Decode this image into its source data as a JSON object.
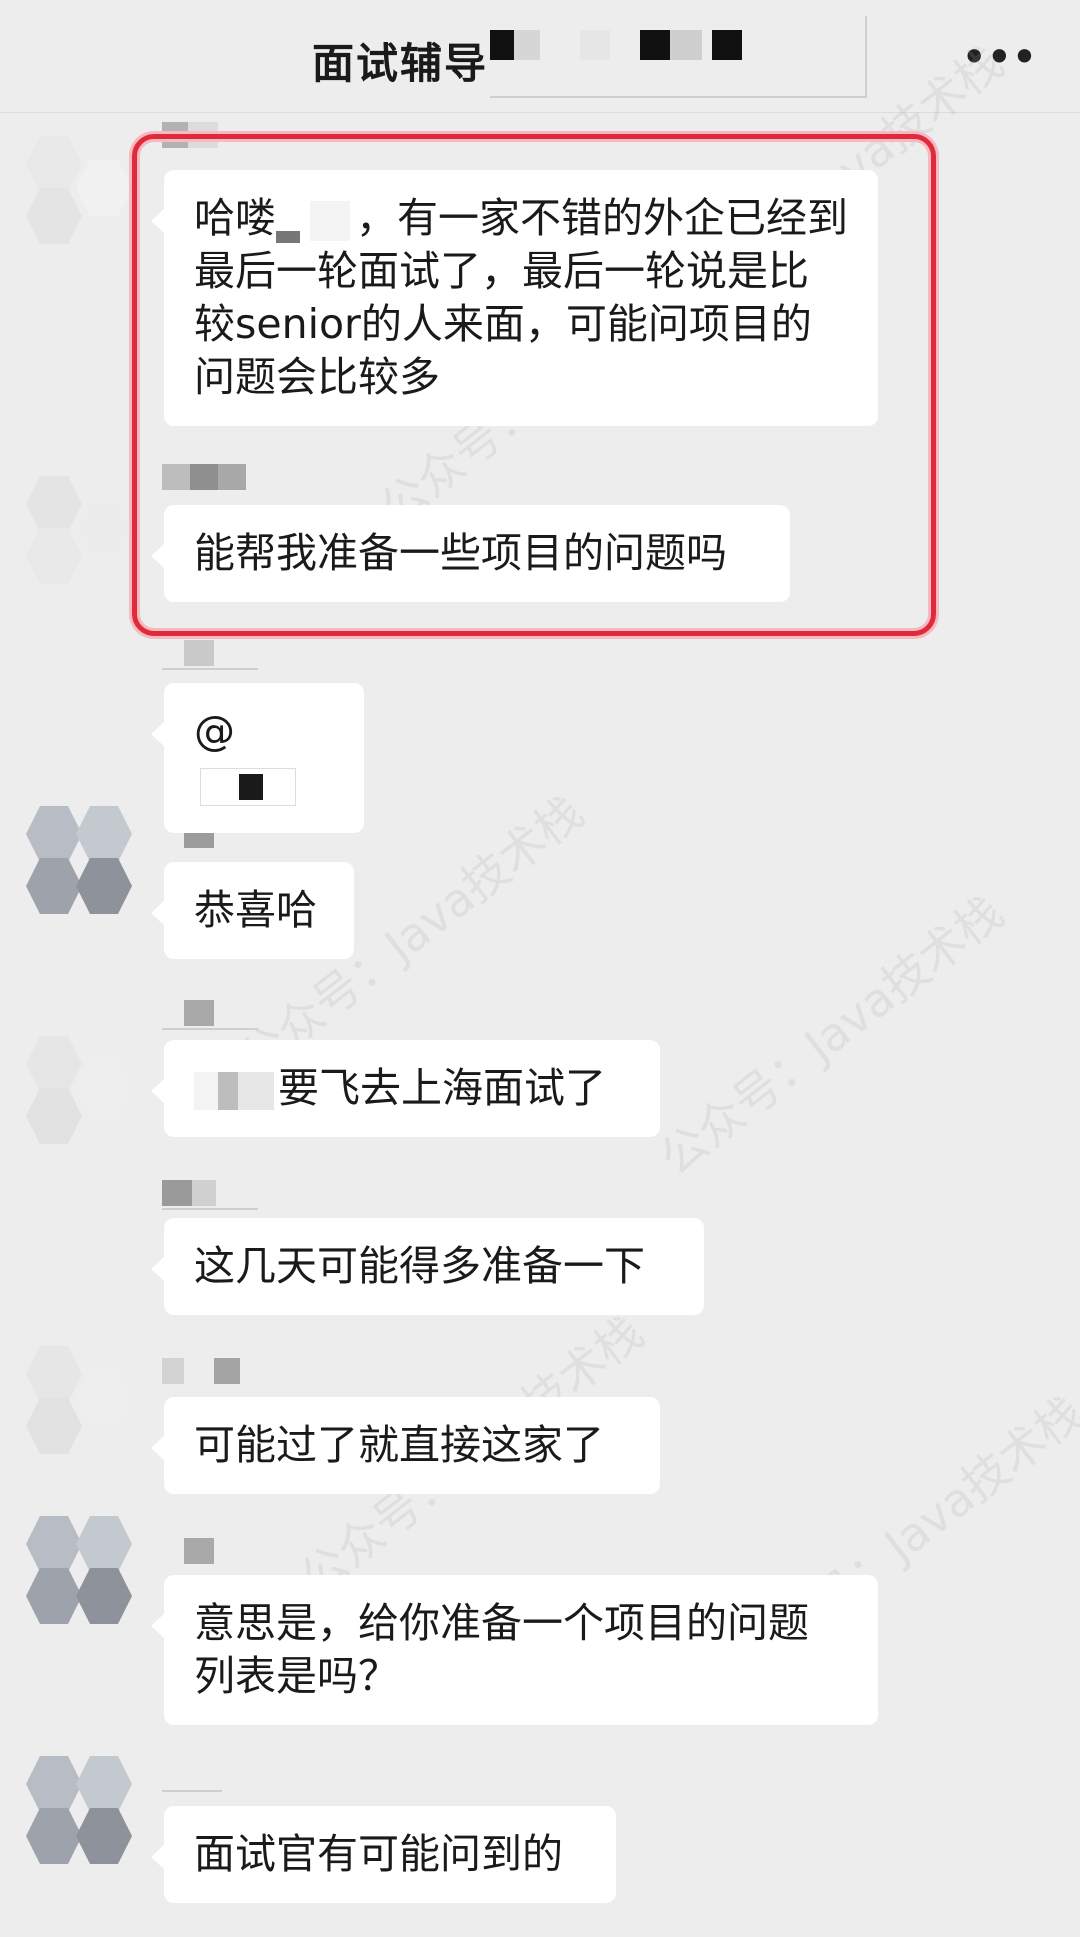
{
  "header": {
    "title": "面试辅导",
    "more_icon": "more-dots-icon"
  },
  "watermark": "公众号：Java技术栈",
  "colors": {
    "background": "#ededed",
    "bubble": "#ffffff",
    "highlight_border": "#e02a3c"
  },
  "messages": [
    {
      "text_a": "哈喽",
      "text_b": "，有一家不错的外企已经到最后一轮面试了，最后一轮说是比较senior的人来面，可能问项目的问题会比较多"
    },
    {
      "text": "能帮我准备一些项目的问题吗"
    },
    {
      "text": "@"
    },
    {
      "text": "恭喜哈"
    },
    {
      "text": "要飞去上海面试了"
    },
    {
      "text": "这几天可能得多准备一下"
    },
    {
      "text": "可能过了就直接这家了"
    },
    {
      "text": "意思是，给你准备一个项目的问题列表是吗？"
    },
    {
      "text": "面试官有可能问到的"
    }
  ]
}
